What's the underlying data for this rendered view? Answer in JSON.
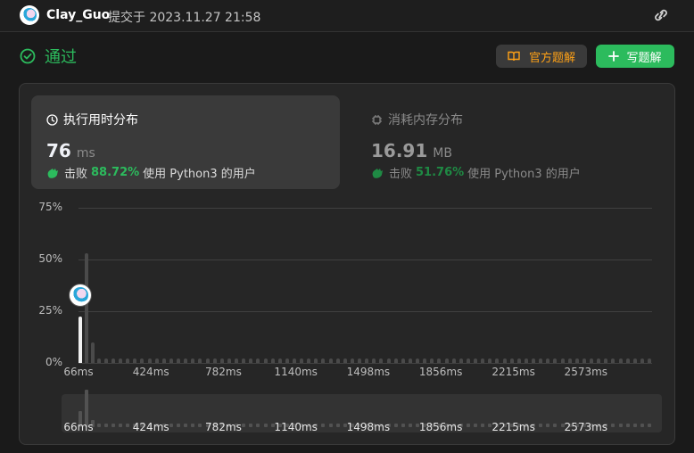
{
  "header": {
    "username": "Clay_Guo",
    "submitted_text": "提交于 2023.11.27 21:58",
    "link_icon": "link-icon"
  },
  "status": {
    "text": "通过",
    "color": "#2cbb5d",
    "icon": "check-circle-icon"
  },
  "actions": {
    "official_solution_label": "官方题解",
    "write_solution_label": "写题解"
  },
  "runtime": {
    "title": "执行用时分布",
    "value": "76",
    "unit": "ms",
    "beats_prefix": "击败",
    "beats_pct": "88.72%",
    "beats_suffix": "使用 Python3 的用户"
  },
  "memory": {
    "title": "消耗内存分布",
    "value": "16.91",
    "unit": "MB",
    "beats_prefix": "击败",
    "beats_pct": "51.76%",
    "beats_suffix": "使用 Python3 的用户"
  },
  "chart_data": {
    "type": "bar",
    "ytick_labels": [
      "75%",
      "50%",
      "25%",
      "0%"
    ],
    "yticks": [
      75,
      50,
      25,
      0
    ],
    "ylim": [
      0,
      75
    ],
    "xtick_labels": [
      "66ms",
      "424ms",
      "782ms",
      "1140ms",
      "1498ms",
      "1856ms",
      "2215ms",
      "2573ms"
    ],
    "xtick_values": [
      66,
      424,
      782,
      1140,
      1498,
      1856,
      2215,
      2573
    ],
    "xlim": [
      66,
      2900
    ],
    "highlight_x": 76,
    "bins": [
      {
        "x": 76,
        "value": 22.5
      },
      {
        "x": 106,
        "value": 53
      },
      {
        "x": 136,
        "value": 10
      }
    ],
    "trailing_bar_value": 2,
    "trailing_bar_start": 166,
    "trailing_bar_step": 35.8
  }
}
